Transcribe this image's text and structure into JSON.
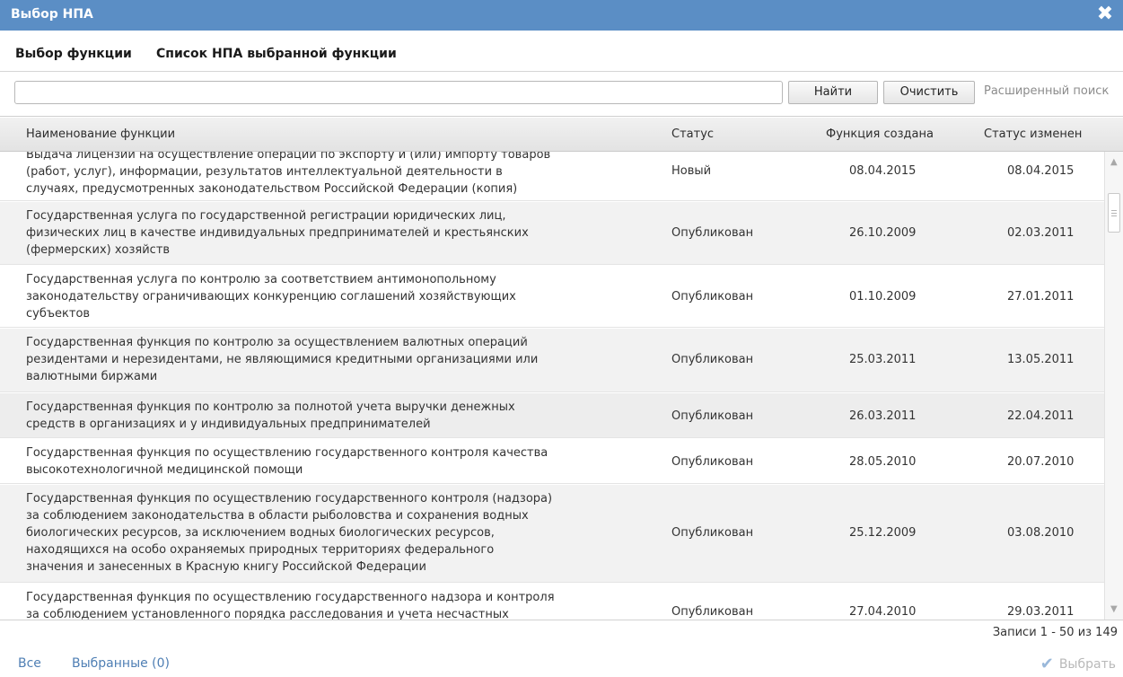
{
  "window": {
    "title": "Выбор НПА",
    "close_symbol": "✖"
  },
  "tabs": [
    {
      "label": "Выбор функции"
    },
    {
      "label": "Список НПА выбранной функции"
    }
  ],
  "search": {
    "value": "",
    "placeholder": "",
    "find_label": "Найти",
    "clear_label": "Очистить",
    "advanced_label": "Расширенный поиск"
  },
  "grid": {
    "columns": {
      "name": "Наименование функции",
      "status": "Статус",
      "created": "Функция создана",
      "changed": "Статус изменен"
    },
    "rows": [
      {
        "lines": [
          "Выдача лицензии на осуществление операций по экспорту и (или) импорту товаров",
          "(работ, услуг), информации, результатов интеллектуальной деятельности в",
          "случаях, предусмотренных законодательством Российской Федерации (копия)"
        ],
        "status": "Новый",
        "created": "08.04.2015",
        "changed": "08.04.2015"
      },
      {
        "lines": [
          "Государственная услуга по государственной регистрации юридических лиц,",
          "физических лиц в качестве индивидуальных предпринимателей и крестьянских",
          "(фермерских) хозяйств"
        ],
        "status": "Опубликован",
        "created": "26.10.2009",
        "changed": "02.03.2011"
      },
      {
        "lines": [
          "Государственная услуга по контролю за соответствием антимонопольному",
          "законодательству ограничивающих конкуренцию соглашений хозяйствующих",
          "субъектов"
        ],
        "status": "Опубликован",
        "created": "01.10.2009",
        "changed": "27.01.2011"
      },
      {
        "lines": [
          "Государственная функция по контролю за осуществлением валютных операций",
          "резидентами и нерезидентами, не являющимися кредитными организациями или",
          "валютными биржами"
        ],
        "status": "Опубликован",
        "created": "25.03.2011",
        "changed": "13.05.2011"
      },
      {
        "lines": [
          "Государственная функция по контролю за полнотой учета выручки денежных",
          "средств в организациях и у индивидуальных предпринимателей"
        ],
        "status": "Опубликован",
        "created": "26.03.2011",
        "changed": "22.04.2011"
      },
      {
        "lines": [
          "Государственная функция по осуществлению государственного контроля качества",
          "высокотехнологичной медицинской помощи"
        ],
        "status": "Опубликован",
        "created": "28.05.2010",
        "changed": "20.07.2010"
      },
      {
        "lines": [
          "Государственная функция по осуществлению государственного контроля (надзора)",
          "за соблюдением законодательства в области рыболовства и сохранения водных",
          "биологических ресурсов, за исключением водных биологических ресурсов,",
          "находящихся на особо охраняемых природных территориях федерального",
          "значения и занесенных в Красную книгу Российской Федерации"
        ],
        "status": "Опубликован",
        "created": "25.12.2009",
        "changed": "03.08.2010"
      },
      {
        "lines": [
          "Государственная функция по осуществлению государственного надзора и контроля",
          "за соблюдением установленного порядка расследования и учета несчастных"
        ],
        "status": "Опубликован",
        "created": "27.04.2010",
        "changed": "29.03.2011"
      }
    ]
  },
  "footer": {
    "records": "Записи 1 - 50 из 149",
    "all_label": "Все",
    "selected_label": "Выбранные (0)",
    "select_label": "Выбрать"
  },
  "icons": {
    "close": "close-icon",
    "scroll_up": "scroll-up-arrow-icon",
    "scroll_down": "scroll-down-arrow-icon",
    "select": "checkmark-icon"
  },
  "colors": {
    "titlebar": "#5b8ec5",
    "row_alt": "#f2f2f2",
    "link": "#4f7fb4"
  }
}
